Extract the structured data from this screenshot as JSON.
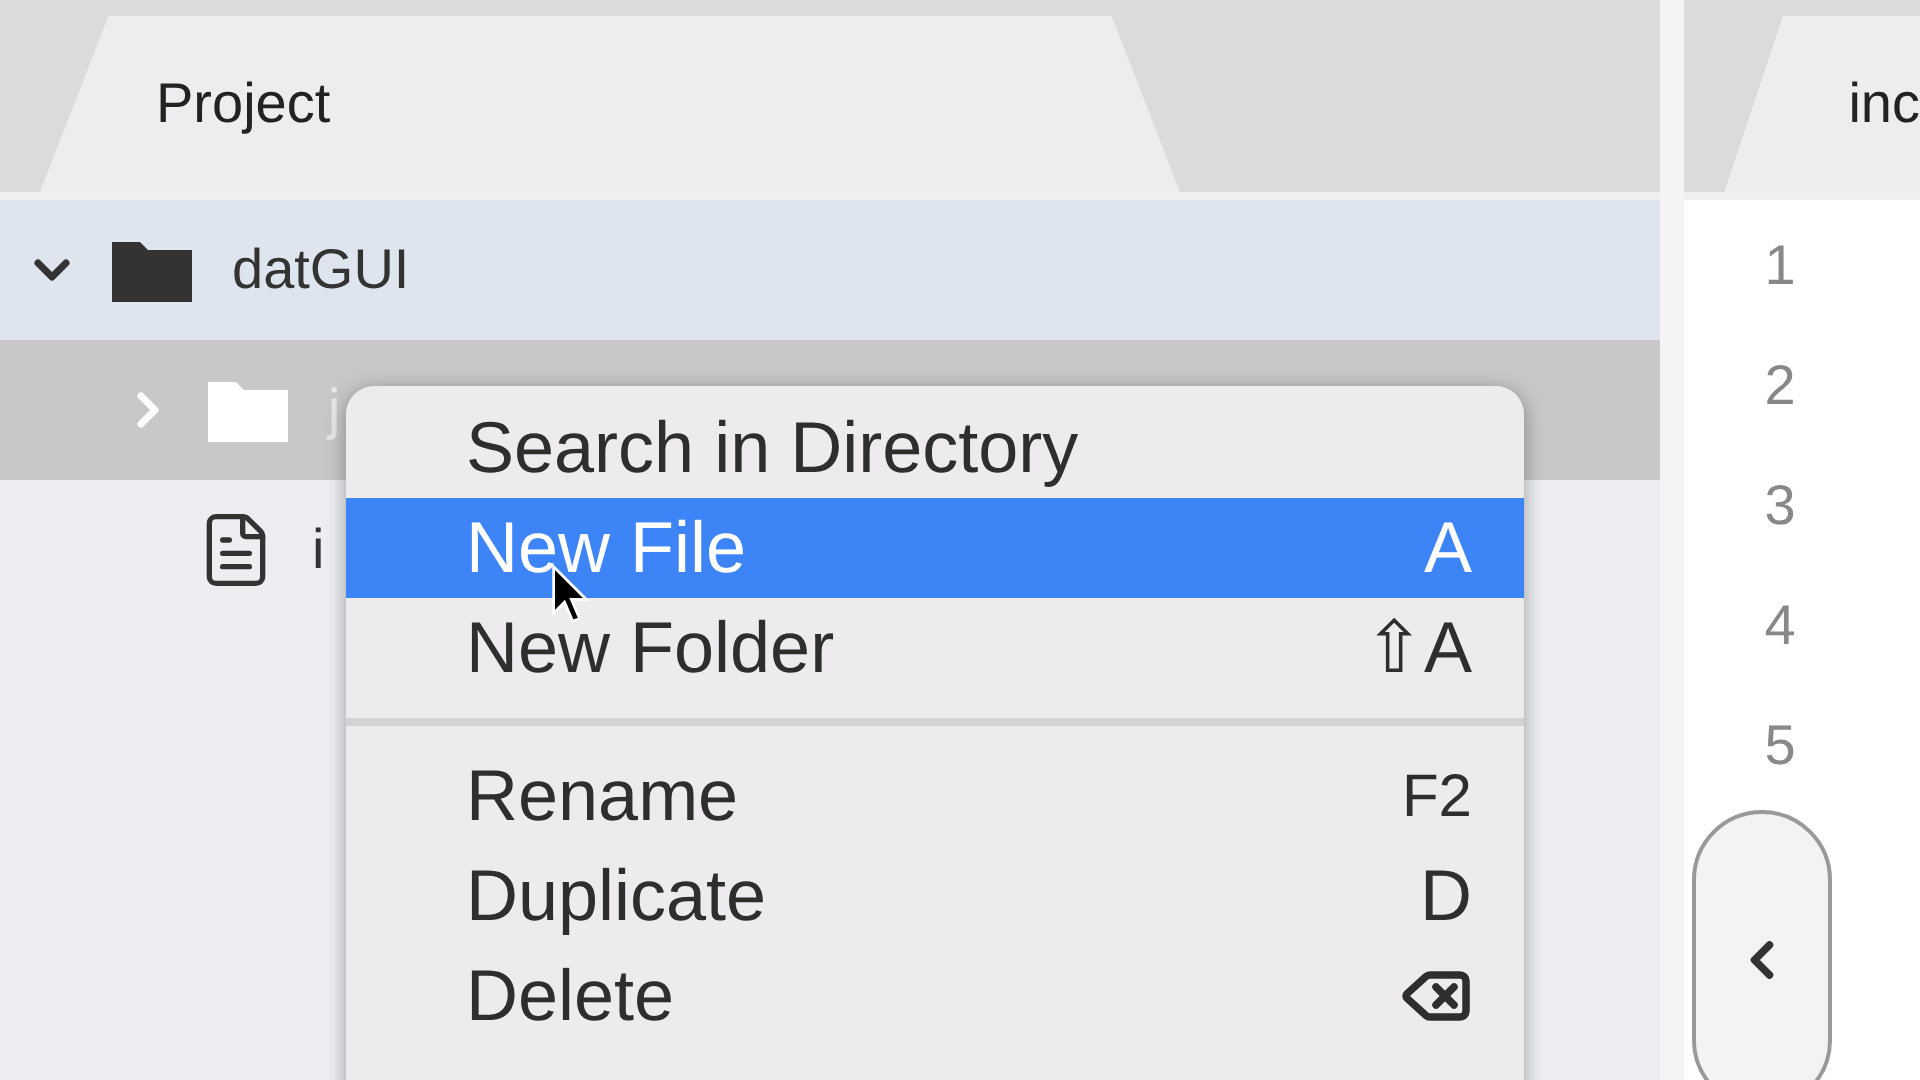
{
  "tabs": [
    {
      "label": "Project"
    },
    {
      "label": "inc"
    }
  ],
  "tree": [
    {
      "name": "datGUI",
      "kind": "folder",
      "expanded": true,
      "selected": false,
      "children": [
        {
          "name": "j",
          "kind": "folder",
          "expanded": false,
          "selected": true
        },
        {
          "name": "i",
          "kind": "file",
          "selected": false
        }
      ]
    }
  ],
  "context_menu": {
    "items": [
      {
        "kind": "item",
        "label": "Search in Directory",
        "selected": false
      },
      {
        "kind": "item",
        "label": "New File",
        "shortcut": "A",
        "selected": true
      },
      {
        "kind": "item",
        "label": "New Folder",
        "shortcut": "⇧A",
        "selected": false
      },
      {
        "kind": "separator"
      },
      {
        "kind": "item",
        "label": "Rename",
        "shortcut": "F2",
        "selected": false
      },
      {
        "kind": "item",
        "label": "Duplicate",
        "shortcut": "D",
        "selected": false
      },
      {
        "kind": "backspace_item",
        "label": "Delete",
        "selected": false
      }
    ]
  },
  "line_numbers": [
    "1",
    "2",
    "3",
    "4",
    "5"
  ]
}
